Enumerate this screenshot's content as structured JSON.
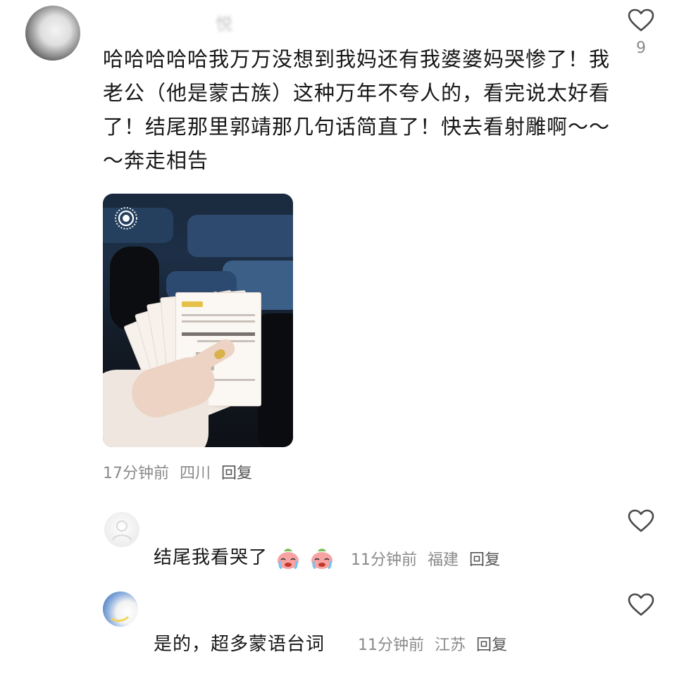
{
  "comments": [
    {
      "username": "悦",
      "text": "哈哈哈哈哈我万万没想到我妈还有我婆婆妈哭惨了！我老公（他是蒙古族）这种万年不夸人的，看完说太好看了！结尾那里郭靖那几句话简直了！快去看射雕啊～～～奔走相告",
      "likes": "9",
      "time": "17分钟前",
      "location": "四川",
      "reply_label": "回复",
      "like_icon": "heart-outline-icon"
    }
  ],
  "replies": [
    {
      "username": "",
      "text": "结尾我看哭了",
      "emoji": "crying-face-emoji",
      "time": "11分钟前",
      "location": "福建",
      "reply_label": "回复",
      "like_icon": "heart-outline-icon"
    },
    {
      "username": "",
      "text": "是的，超多蒙语台词",
      "time": "11分钟前",
      "location": "江苏",
      "reply_label": "回复",
      "like_icon": "heart-outline-icon"
    }
  ],
  "image": {
    "live_icon": "live-photo-icon"
  }
}
